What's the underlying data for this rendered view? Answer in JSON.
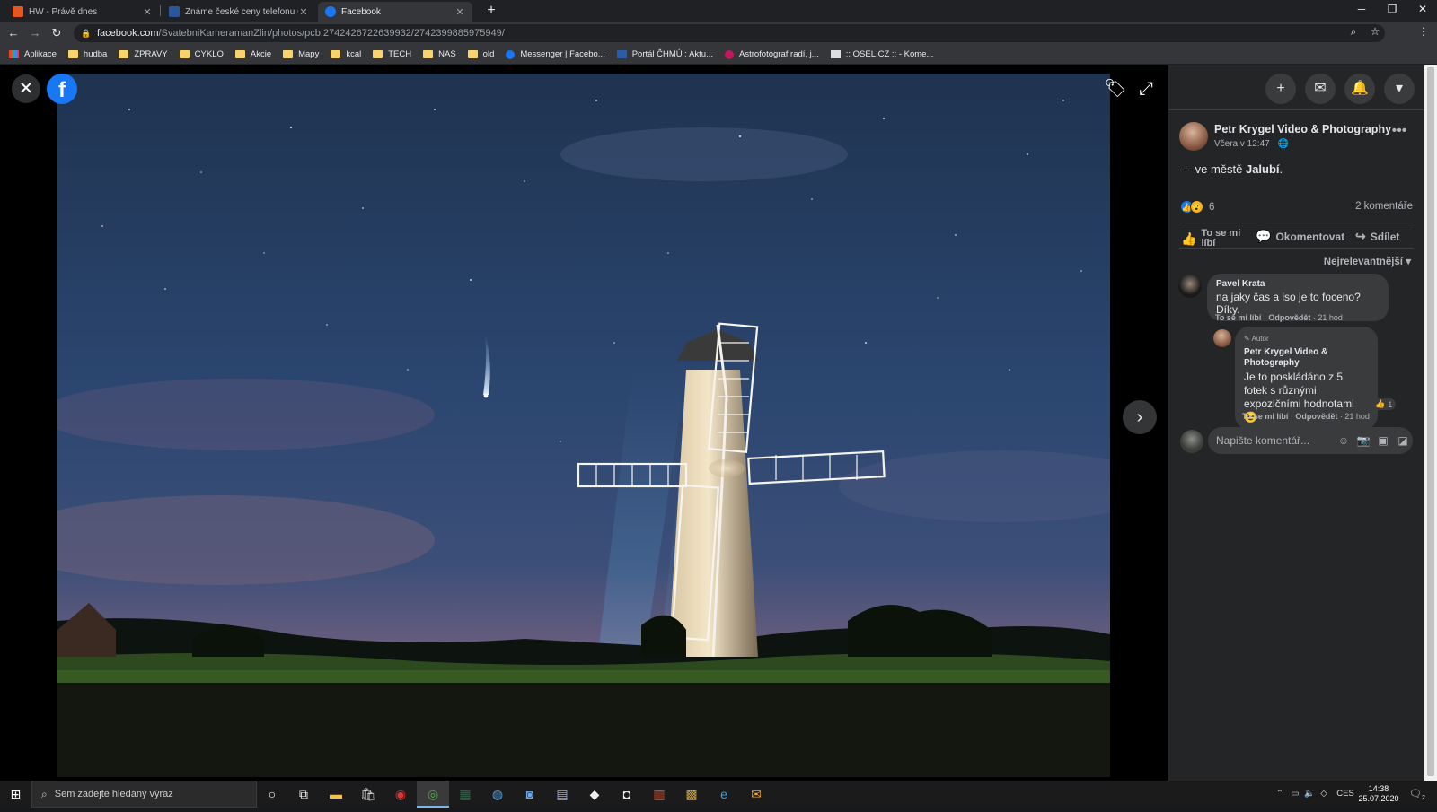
{
  "tabs": [
    {
      "title": "HW - Právě dnes",
      "favicon_color": "#e8561f"
    },
    {
      "title": "Známe české ceny telefonu OnePlus",
      "favicon_color": "#2b579a"
    },
    {
      "title": "Facebook",
      "favicon_color": "#1877f2"
    }
  ],
  "address": {
    "host": "facebook.com",
    "path": "/SvatebniKameramanZlin/photos/pcb.2742426722639932/2742399885975949/"
  },
  "bookmarks": [
    {
      "label": "Aplikace",
      "icon": "apps-grid-icon"
    },
    {
      "label": "hudba",
      "icon": "folder-icon"
    },
    {
      "label": "ZPRAVY",
      "icon": "folder-icon"
    },
    {
      "label": "CYKLO",
      "icon": "folder-icon"
    },
    {
      "label": "Akcie",
      "icon": "folder-icon"
    },
    {
      "label": "Mapy",
      "icon": "folder-icon"
    },
    {
      "label": "kcal",
      "icon": "folder-icon"
    },
    {
      "label": "TECH",
      "icon": "folder-icon"
    },
    {
      "label": "NAS",
      "icon": "folder-icon"
    },
    {
      "label": "old",
      "icon": "folder-icon"
    },
    {
      "label": "Messenger | Facebo...",
      "icon": "facebook-icon"
    },
    {
      "label": "Portál ČHMÚ : Aktu...",
      "icon": "chmu-icon"
    },
    {
      "label": "Astrofotograf radí, j...",
      "icon": "astro-icon"
    },
    {
      "label": ":: OSEL.CZ :: - Kome...",
      "icon": "osel-icon"
    }
  ],
  "viewer": {
    "logo": "f",
    "close_glyph": "✕",
    "next_glyph": "›"
  },
  "post": {
    "author": "Petr Krygel Video & Photography",
    "time": "Včera v 12:47 ·",
    "text_prefix": "— ve městě ",
    "place": "Jalubí",
    "text_suffix": ".",
    "reaction_count": "6",
    "comments_count": "2 komentáře",
    "actions": {
      "like": "To se mi líbí",
      "comment": "Okomentovat",
      "share": "Sdílet"
    },
    "sort_label": "Nejrelevantnější"
  },
  "comments": [
    {
      "author": "Pavel Krata",
      "text": "na jaky čas a iso je to foceno? Díky.",
      "meta_like": "To se mi líbí",
      "meta_reply": "Odpovědět",
      "meta_time": "21 hod"
    }
  ],
  "reply": {
    "badge": "Autor",
    "author": "Petr Krygel Video & Photography",
    "text": "Je to poskládáno z 5 fotek s různými expozičními hodnotami",
    "emoji": "😉",
    "likes": "1",
    "meta_like": "To se mi líbí",
    "meta_reply": "Odpovědět",
    "meta_time": "21 hod"
  },
  "compose": {
    "placeholder": "Napište komentář..."
  },
  "taskbar": {
    "search_placeholder": "Sem zadejte hledaný výraz",
    "lang": "CES",
    "time": "14:38",
    "date": "25.07.2020",
    "notifications": "2"
  }
}
